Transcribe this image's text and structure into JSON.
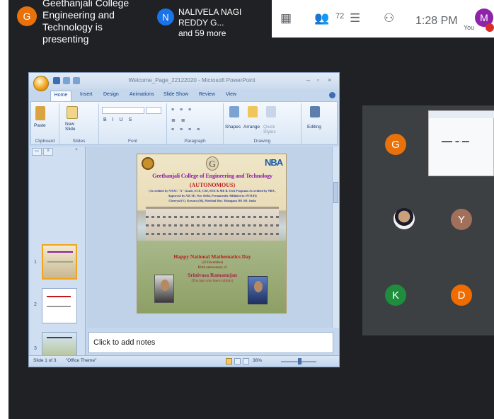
{
  "meet": {
    "presenter": {
      "initial": "G",
      "avatar_color": "#e8710a",
      "text": "Geethanjali College Engineering and Technology is presenting"
    },
    "participants": {
      "initial": "N",
      "avatar_color": "#1a73e8",
      "name": "NALIVELA NAGI REDDY G...",
      "more": "and 59 more"
    },
    "controls": {
      "participant_count": "72",
      "time": "1:28 PM",
      "self_label": "You",
      "self_initial": "M",
      "self_color": "#8e24aa"
    },
    "tiles": [
      {
        "initial": "G",
        "color": "#e8710a"
      },
      {
        "initial": "Y",
        "color": "#a0705a"
      },
      {
        "initial": "K",
        "color": "#1e8e3e"
      },
      {
        "initial": "D",
        "color": "#f06c00"
      }
    ]
  },
  "powerpoint": {
    "title": "Welcome_Page_22122020 - Microsoft PowerPoint",
    "tabs": [
      "Home",
      "Insert",
      "Design",
      "Animations",
      "Slide Show",
      "Review",
      "View"
    ],
    "ribbon": {
      "paste": "Paste",
      "new_slide": "New Slide",
      "shapes": "Shapes",
      "arrange": "Arrange",
      "quick_styles": "Quick Styles",
      "editing": "Editing",
      "groups": [
        "Clipboard",
        "Slides",
        "Font",
        "Paragraph",
        "Drawing"
      ]
    },
    "slide": {
      "college_name": "Geethanjali College of Engineering and Technology",
      "autonomous": "(AUTONOMOUS)",
      "accreditation_1": "(Accredited by NAAC \"A\" Grade, ECE, CSE, EEE & ME B. Tech Programs Accredited by NBA ,",
      "accreditation_2": "Approved by AICTE, New Delhi, Permanently Affiliated to JNTUH)",
      "address": "Cheeryal (V), Keesara (M), Medchal Dist. Telangana 501 301, India",
      "event": "Happy National Mathematics Day",
      "date": "(22 December)",
      "anniversary": "Birth anniversary of",
      "person": "Srinivasa Ramanujan",
      "tagline": "(The man who knew infinity)"
    },
    "notes_placeholder": "Click to add notes",
    "status": {
      "slide_info": "Slide 1 of 3",
      "theme": "\"Office Theme\"",
      "zoom": "38%"
    }
  }
}
